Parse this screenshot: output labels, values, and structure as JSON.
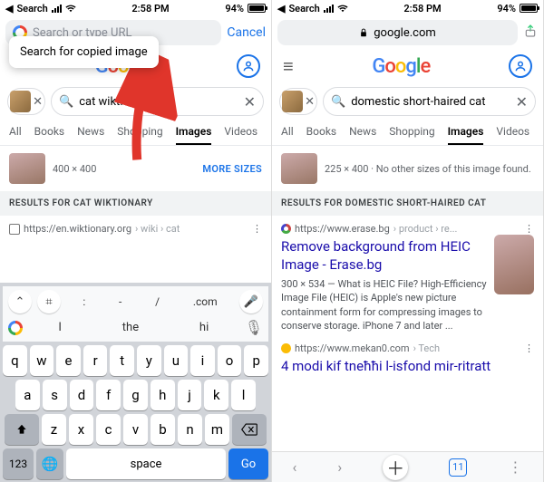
{
  "status": {
    "carrier": "Search",
    "time": "2:58 PM",
    "battery": "94%"
  },
  "left": {
    "urlbar": {
      "placeholder": "Search or type URL",
      "cancel": "Cancel"
    },
    "popover": "Search for copied image",
    "query": "cat wiktionary",
    "tabs": [
      "All",
      "Books",
      "News",
      "Shopping",
      "Images",
      "Videos"
    ],
    "active_tab_index": 4,
    "sizes_label": "400 × 400",
    "more_sizes": "MORE SIZES",
    "results_header": "RESULTS FOR CAT WIKTIONARY",
    "result1": {
      "breadcrumb_host": "https://en.wiktionary.org",
      "breadcrumb_path": "› wiki › cat"
    },
    "kb": {
      "sugg1": [
        ":",
        "-",
        "/",
        ".com"
      ],
      "sugg2": [
        "I",
        "the",
        "hi"
      ],
      "rows": [
        [
          "q",
          "w",
          "e",
          "r",
          "t",
          "y",
          "u",
          "i",
          "o",
          "p"
        ],
        [
          "a",
          "s",
          "d",
          "f",
          "g",
          "h",
          "j",
          "k",
          "l"
        ],
        [
          "z",
          "x",
          "c",
          "v",
          "b",
          "n",
          "m"
        ]
      ],
      "num": "123",
      "space": "space",
      "go": "Go"
    }
  },
  "right": {
    "url_host": "google.com",
    "query": "domestic short-haired cat",
    "tabs": [
      "All",
      "Books",
      "News",
      "Shopping",
      "Images",
      "Videos"
    ],
    "active_tab_index": 4,
    "sizes_label": "225 × 400 · No other sizes of this image found.",
    "results_header": "RESULTS FOR DOMESTIC SHORT-HAIRED CAT",
    "r1": {
      "host": "https://www.erase.bg",
      "path": "› product › re...",
      "title": "Remove background from HEIC Image - Erase.bg",
      "desc": "300 × 534 — What is HEIC File? High-Efficiency Image File (HEIC) is Apple's new picture containment form for compressing images to conserve storage. iPhone 7 and later ..."
    },
    "r2": {
      "host": "https://www.mekan0.com",
      "path": "› Tech",
      "title": "4 modi kif tneħħi l-isfond mir-ritratt"
    },
    "tab_count": "11"
  }
}
